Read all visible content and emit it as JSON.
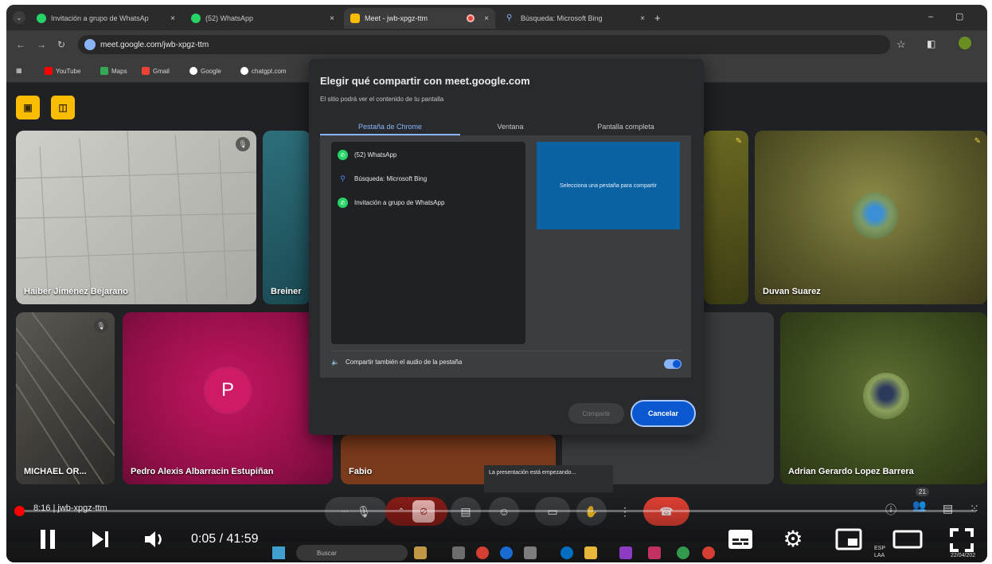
{
  "browser": {
    "tabs": [
      {
        "label": "Invitación a grupo de WhatsAp",
        "close": "×"
      },
      {
        "label": "(52) WhatsApp",
        "close": "×"
      },
      {
        "label": "Meet - jwb-xpgz-ttm",
        "close": "×"
      },
      {
        "label": "Búsqueda: Microsoft Bing",
        "close": "×"
      }
    ],
    "new_tab": "+",
    "url": "meet.google.com/jwb-xpgz-ttm",
    "bookmarks": [
      "YouTube",
      "Maps",
      "Gmail",
      "Google",
      "chatgpt.com"
    ],
    "window_controls": [
      "–",
      "▢"
    ]
  },
  "meet": {
    "tiles": [
      {
        "name": "Haiber Jiménez Bejarano"
      },
      {
        "name": "Breiner"
      },
      {
        "name": "Duvan Suarez"
      },
      {
        "name": "MICHAEL OR..."
      },
      {
        "name": "Pedro Alexis Albarracin Estupiñan",
        "initial": "P"
      },
      {
        "name": "Fabio"
      },
      {
        "name": "Adrian Gerardo Lopez Barrera"
      }
    ],
    "participants_count": "21",
    "tooltip": "La presentación está empezando...",
    "meeting_code": "8:16  |  jwb-xpgz-ttm"
  },
  "share_dialog": {
    "title": "Elegir qué compartir con meet.google.com",
    "subtitle": "El sitio podrá ver el contenido de tu pantalla",
    "tabs": [
      "Pestaña de Chrome",
      "Ventana",
      "Pantalla completa"
    ],
    "selected_tab": "Pestaña de Chrome",
    "items": [
      {
        "label": "(52) WhatsApp",
        "icon": "whatsapp-icon"
      },
      {
        "label": "Búsqueda: Microsoft Bing",
        "icon": "search-icon"
      },
      {
        "label": "Invitación a grupo de WhatsApp",
        "icon": "whatsapp-icon"
      }
    ],
    "preview_text": "Selecciona una pestaña para compartir",
    "audio_label": "Compartir también el audio de la pestaña",
    "audio_enabled": true,
    "share_label": "Compartir",
    "cancel_label": "Cancelar"
  },
  "player": {
    "current_time": "0:05 / 41:59",
    "progress_fraction": 0.002
  },
  "taskbar": {
    "search_placeholder": "Buscar",
    "lang": "ESP\nLAA",
    "date": "22/04/202"
  },
  "colors": {
    "accent_blue": "#8ab4f8",
    "end_call_red": "#e94235",
    "youtube_red": "#ff0000",
    "meet_yellow": "#fbbc04"
  }
}
